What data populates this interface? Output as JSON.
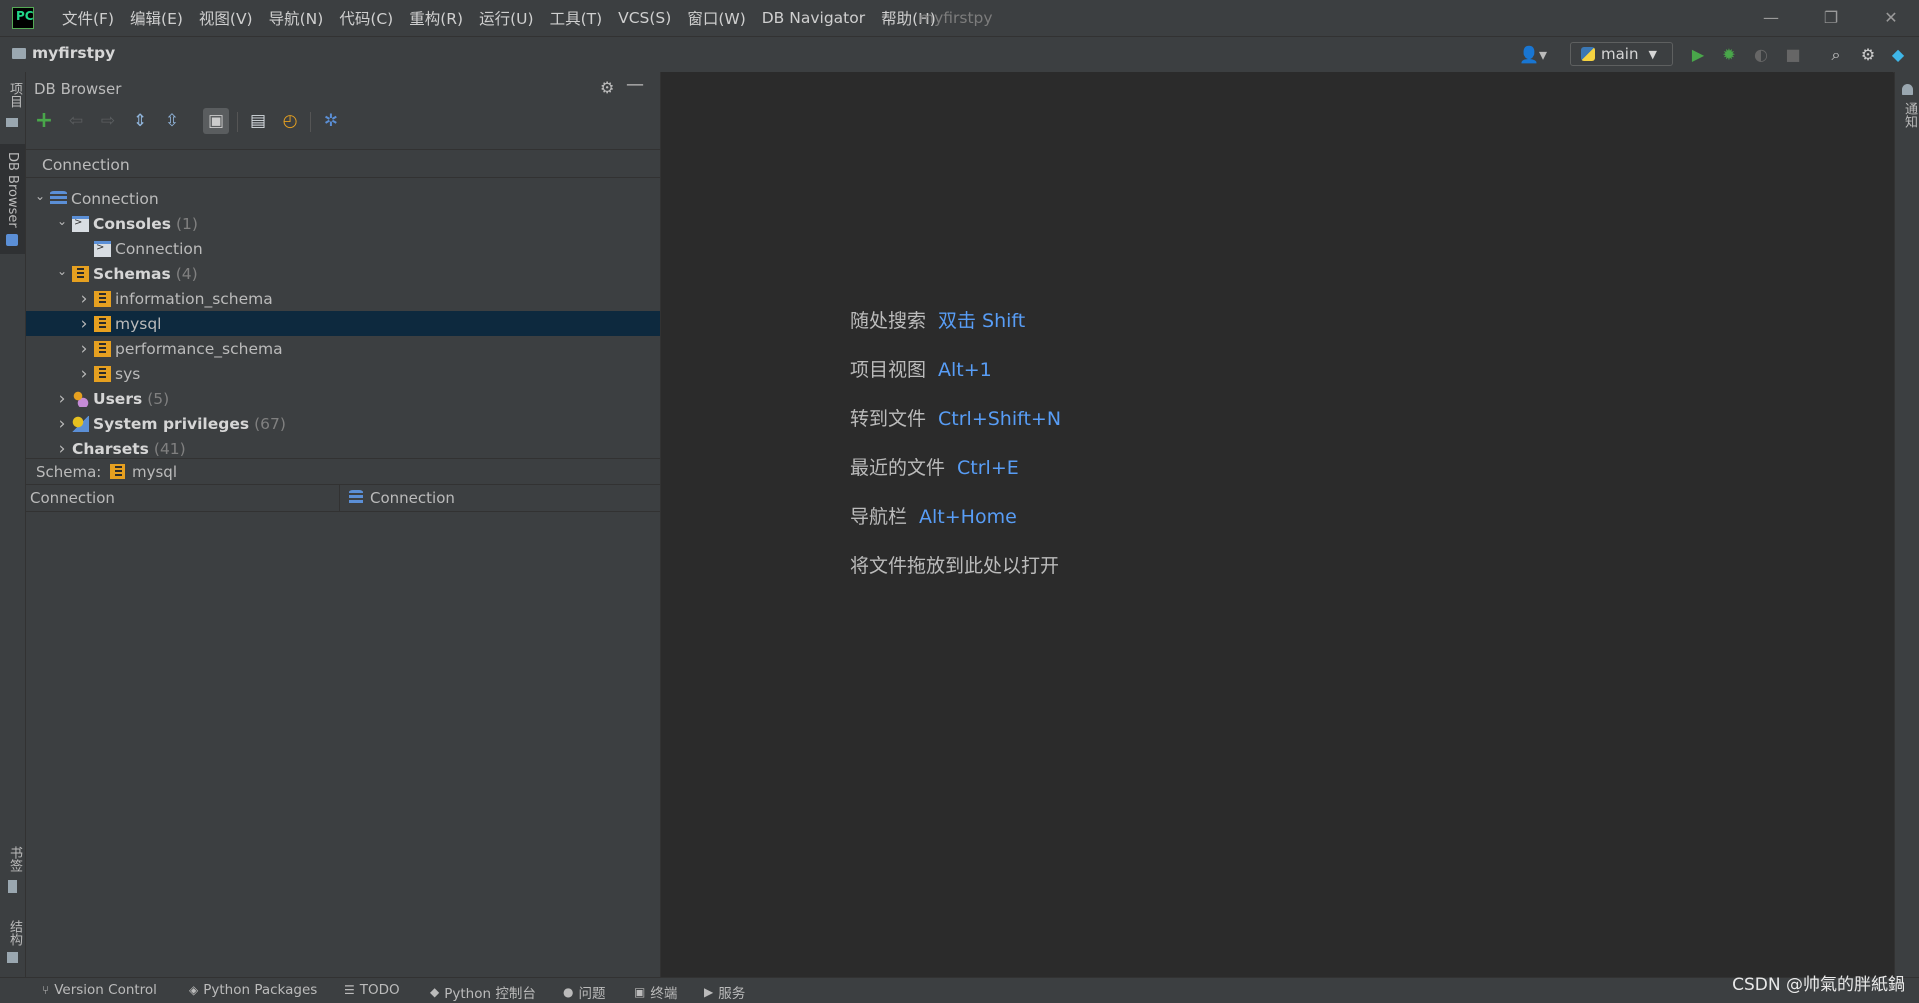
{
  "menu": [
    "文件(F)",
    "编辑(E)",
    "视图(V)",
    "导航(N)",
    "代码(C)",
    "重构(R)",
    "运行(U)",
    "工具(T)",
    "VCS(S)",
    "窗口(W)",
    "DB Navigator",
    "帮助(H)"
  ],
  "window_title": "myfirstpy",
  "navbar": {
    "project": "myfirstpy",
    "run_config": "main"
  },
  "left_stripe": {
    "project": "项目",
    "db_browser": "DB Browser",
    "bookmarks": "书签",
    "structure": "结构"
  },
  "right_stripe": {
    "notifications": "通知"
  },
  "db_browser": {
    "title": "DB Browser",
    "connection_label": "Connection",
    "tree": [
      {
        "label": "Connection",
        "level": 0,
        "expanded": true,
        "icon": "database-icon",
        "bold": false,
        "count": ""
      },
      {
        "label": "Consoles",
        "level": 1,
        "expanded": true,
        "icon": "consoles-icon",
        "bold": true,
        "count": "(1)"
      },
      {
        "label": "Connection",
        "level": 2,
        "expanded": null,
        "icon": "console-icon",
        "bold": false,
        "count": ""
      },
      {
        "label": "Schemas",
        "level": 1,
        "expanded": true,
        "icon": "schemas-icon",
        "bold": true,
        "count": "(4)"
      },
      {
        "label": "information_schema",
        "level": 2,
        "expanded": false,
        "icon": "schema-icon",
        "bold": false,
        "count": ""
      },
      {
        "label": "mysql",
        "level": 2,
        "expanded": false,
        "icon": "schema-icon",
        "bold": false,
        "count": "",
        "selected": true
      },
      {
        "label": "performance_schema",
        "level": 2,
        "expanded": false,
        "icon": "schema-icon",
        "bold": false,
        "count": ""
      },
      {
        "label": "sys",
        "level": 2,
        "expanded": false,
        "icon": "schema-icon",
        "bold": false,
        "count": ""
      },
      {
        "label": "Users",
        "level": 1,
        "expanded": false,
        "icon": "users-icon",
        "bold": true,
        "count": "(5)"
      },
      {
        "label": "System privileges",
        "level": 1,
        "expanded": false,
        "icon": "privileges-icon",
        "bold": true,
        "count": "(67)"
      },
      {
        "label": "Charsets",
        "level": 1,
        "expanded": false,
        "icon": null,
        "bold": true,
        "count": "(41)"
      }
    ],
    "schema_label": "Schema:",
    "schema_value": "mysql",
    "props": {
      "key": "Connection",
      "value": "Connection"
    }
  },
  "editor_hints": [
    {
      "label": "随处搜索",
      "key": "双击 Shift"
    },
    {
      "label": "项目视图",
      "key": "Alt+1"
    },
    {
      "label": "转到文件",
      "key": "Ctrl+Shift+N"
    },
    {
      "label": "最近的文件",
      "key": "Ctrl+E"
    },
    {
      "label": "导航栏",
      "key": "Alt+Home"
    },
    {
      "label": "将文件拖放到此处以打开",
      "key": ""
    }
  ],
  "statusbar": [
    "Version Control",
    "Python Packages",
    "TODO",
    "Python 控制台",
    "问题",
    "终端",
    "服务"
  ],
  "watermark": "CSDN @帅氣的胖紙鍋"
}
